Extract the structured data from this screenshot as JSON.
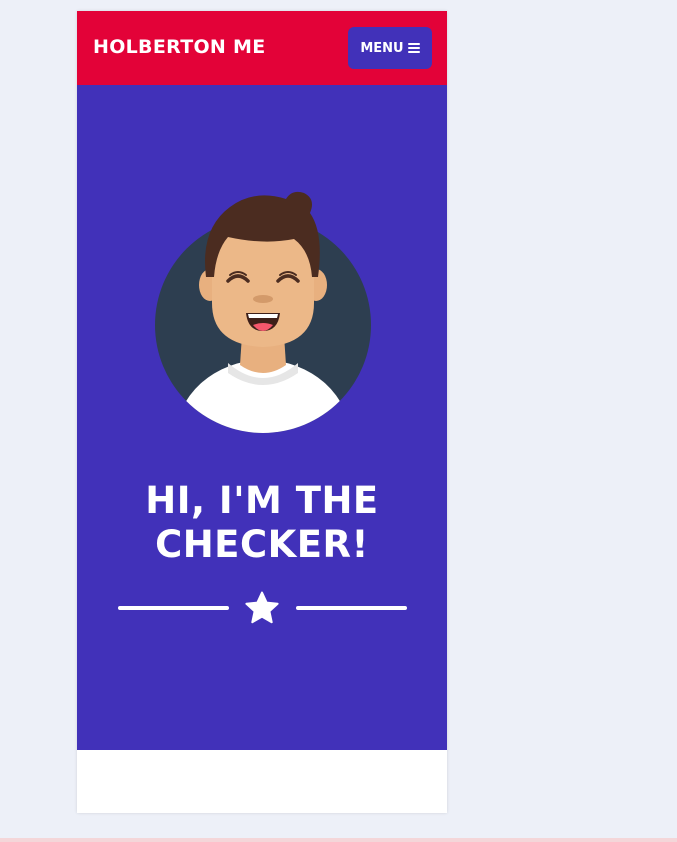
{
  "navbar": {
    "brand": "HOLBERTON ME",
    "menu_label": "MENU",
    "menu_icon": "bars-icon"
  },
  "hero": {
    "avatar_icon": "avatar-illustration",
    "title": "HI, I'M THE CHECKER!",
    "divider_icon": "star-icon"
  },
  "colors": {
    "navbar_bg": "#e30238",
    "hero_bg": "#4131b9",
    "menu_button_bg": "#4131b9",
    "page_bg": "#edf0f8",
    "text": "#ffffff"
  }
}
